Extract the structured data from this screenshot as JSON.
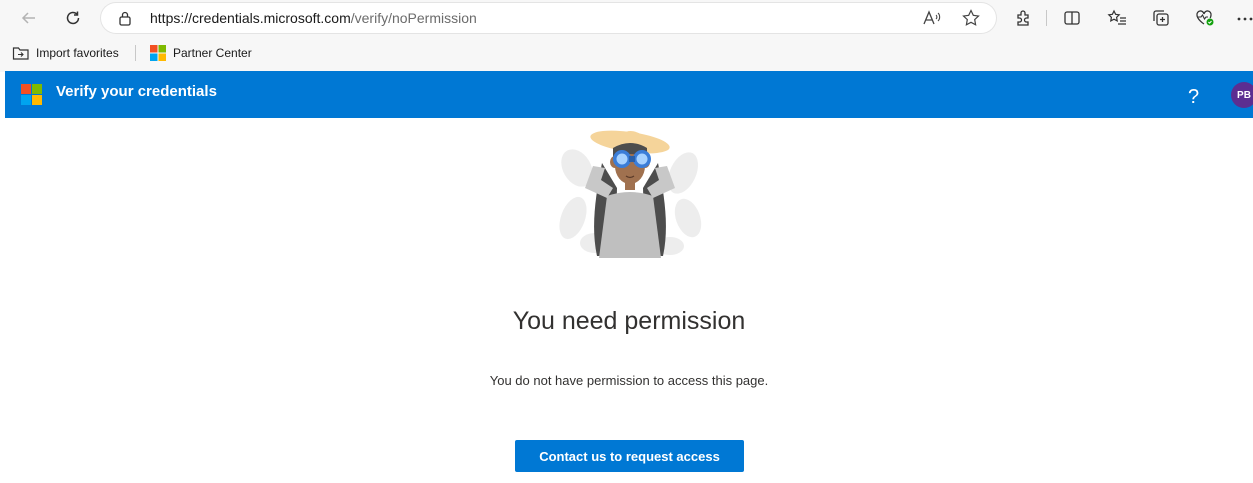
{
  "browser": {
    "url_host": "https://credentials.microsoft.com",
    "url_path": "/verify/noPermission",
    "icons": {
      "back": "back-arrow-icon",
      "refresh": "refresh-icon",
      "lock": "lock-icon",
      "read_aloud": "read-aloud-icon",
      "favorite": "star-icon",
      "extensions": "extensions-icon",
      "split_screen": "split-screen-icon",
      "favorites_list": "favorites-list-icon",
      "collections": "collections-icon",
      "browser_essentials": "heart-pulse-icon",
      "more": "more-icon"
    },
    "favorites": [
      {
        "label": "Import favorites",
        "icon": "import-favorites-icon"
      },
      {
        "label": "Partner Center",
        "icon": "microsoft-logo-icon"
      }
    ]
  },
  "header": {
    "title": "Verify your credentials",
    "help_label": "?",
    "avatar_initials": "PB",
    "colors": {
      "bar": "#0078d4",
      "avatar": "#5c2e91"
    }
  },
  "main": {
    "heading": "You need permission",
    "message": "You do not have permission to access this page.",
    "cta_label": "Contact us to request access",
    "illustration": "woman-with-binoculars-illustration"
  }
}
